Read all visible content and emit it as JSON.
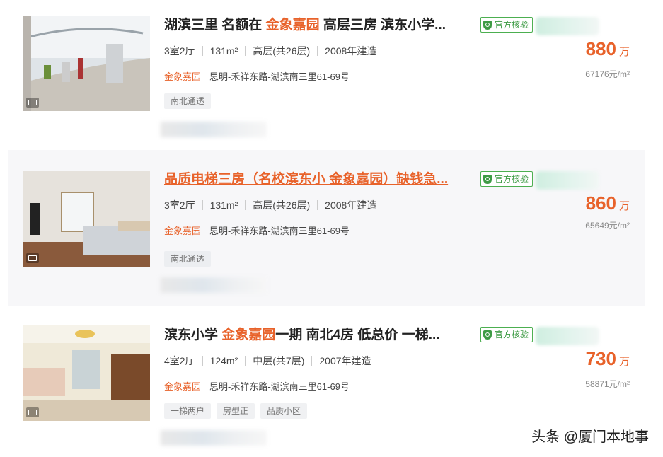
{
  "listings": [
    {
      "title_parts": [
        "湖滨三里 名额在 ",
        "金象嘉园",
        " 高层三房 滨东小学..."
      ],
      "verified": "官方核验",
      "rooms": "3室2厅",
      "area": "131m²",
      "floor": "高层(共26层)",
      "built": "2008年建造",
      "community": "金象嘉园",
      "address": "思明-禾祥东路-湖滨南三里61-69号",
      "tags": [
        "南北通透"
      ],
      "price": "880",
      "price_unit": "万",
      "unit_price": "67176元/m²"
    },
    {
      "title": "品质电梯三房（名校滨东小 金象嘉园）缺钱急...",
      "verified": "官方核验",
      "rooms": "3室2厅",
      "area": "131m²",
      "floor": "高层(共26层)",
      "built": "2008年建造",
      "community": "金象嘉园",
      "address": "思明-禾祥东路-湖滨南三里61-69号",
      "tags": [
        "南北通透"
      ],
      "price": "860",
      "price_unit": "万",
      "unit_price": "65649元/m²"
    },
    {
      "title_parts": [
        "滨东小学 ",
        "金象嘉园",
        "一期 南北4房 低总价 一梯..."
      ],
      "verified": "官方核验",
      "rooms": "4室2厅",
      "area": "124m²",
      "floor": "中层(共7层)",
      "built": "2007年建造",
      "community": "金象嘉园",
      "address": "思明-禾祥东路-湖滨南三里61-69号",
      "tags": [
        "一梯两户",
        "房型正",
        "品质小区"
      ],
      "price": "730",
      "price_unit": "万",
      "unit_price": "58871元/m²"
    }
  ],
  "watermark": "头条 @厦门本地事",
  "colors": {
    "accent": "#e8622a",
    "verify": "#3e9b45"
  }
}
